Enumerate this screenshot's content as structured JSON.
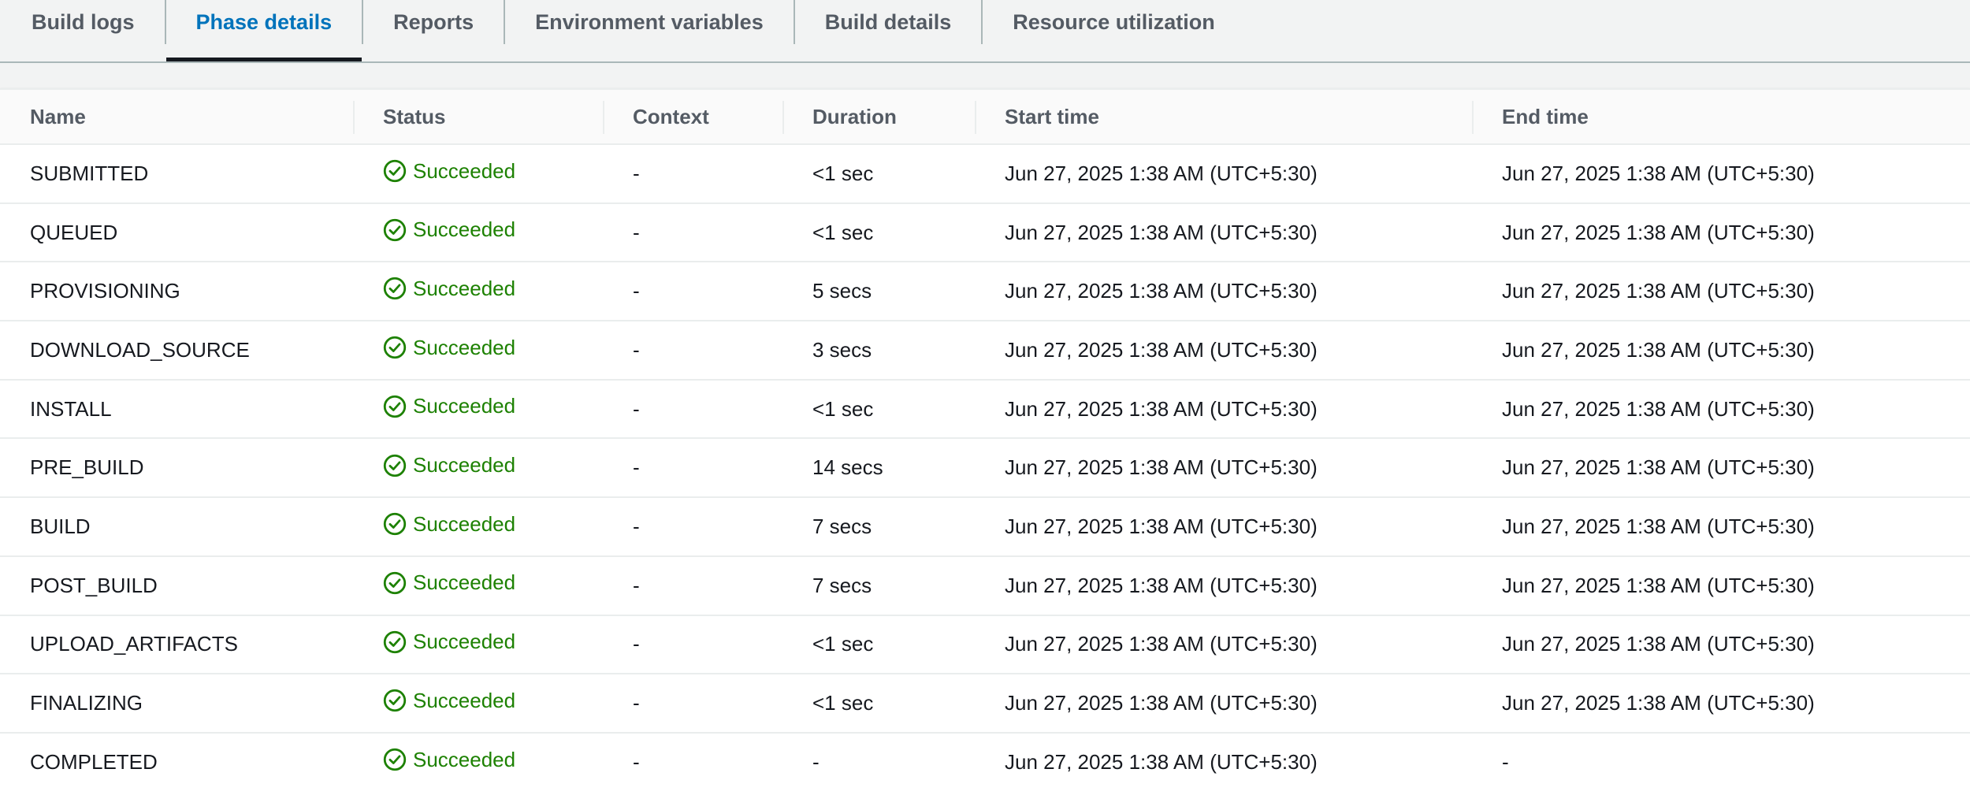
{
  "tabs": [
    {
      "label": "Build logs",
      "active": false
    },
    {
      "label": "Phase details",
      "active": true
    },
    {
      "label": "Reports",
      "active": false
    },
    {
      "label": "Environment variables",
      "active": false
    },
    {
      "label": "Build details",
      "active": false
    },
    {
      "label": "Resource utilization",
      "active": false
    }
  ],
  "table": {
    "headers": [
      "Name",
      "Status",
      "Context",
      "Duration",
      "Start time",
      "End time"
    ],
    "status_icon": "check-circle-icon",
    "colors": {
      "success": "#1d8102",
      "active_tab": "#0073bb"
    },
    "rows": [
      {
        "name": "SUBMITTED",
        "status": "Succeeded",
        "context": "-",
        "duration": "<1 sec",
        "start": "Jun 27, 2025 1:38 AM (UTC+5:30)",
        "end": "Jun 27, 2025 1:38 AM (UTC+5:30)"
      },
      {
        "name": "QUEUED",
        "status": "Succeeded",
        "context": "-",
        "duration": "<1 sec",
        "start": "Jun 27, 2025 1:38 AM (UTC+5:30)",
        "end": "Jun 27, 2025 1:38 AM (UTC+5:30)"
      },
      {
        "name": "PROVISIONING",
        "status": "Succeeded",
        "context": "-",
        "duration": "5 secs",
        "start": "Jun 27, 2025 1:38 AM (UTC+5:30)",
        "end": "Jun 27, 2025 1:38 AM (UTC+5:30)"
      },
      {
        "name": "DOWNLOAD_SOURCE",
        "status": "Succeeded",
        "context": "-",
        "duration": "3 secs",
        "start": "Jun 27, 2025 1:38 AM (UTC+5:30)",
        "end": "Jun 27, 2025 1:38 AM (UTC+5:30)"
      },
      {
        "name": "INSTALL",
        "status": "Succeeded",
        "context": "-",
        "duration": "<1 sec",
        "start": "Jun 27, 2025 1:38 AM (UTC+5:30)",
        "end": "Jun 27, 2025 1:38 AM (UTC+5:30)"
      },
      {
        "name": "PRE_BUILD",
        "status": "Succeeded",
        "context": "-",
        "duration": "14 secs",
        "start": "Jun 27, 2025 1:38 AM (UTC+5:30)",
        "end": "Jun 27, 2025 1:38 AM (UTC+5:30)"
      },
      {
        "name": "BUILD",
        "status": "Succeeded",
        "context": "-",
        "duration": "7 secs",
        "start": "Jun 27, 2025 1:38 AM (UTC+5:30)",
        "end": "Jun 27, 2025 1:38 AM (UTC+5:30)"
      },
      {
        "name": "POST_BUILD",
        "status": "Succeeded",
        "context": "-",
        "duration": "7 secs",
        "start": "Jun 27, 2025 1:38 AM (UTC+5:30)",
        "end": "Jun 27, 2025 1:38 AM (UTC+5:30)"
      },
      {
        "name": "UPLOAD_ARTIFACTS",
        "status": "Succeeded",
        "context": "-",
        "duration": "<1 sec",
        "start": "Jun 27, 2025 1:38 AM (UTC+5:30)",
        "end": "Jun 27, 2025 1:38 AM (UTC+5:30)"
      },
      {
        "name": "FINALIZING",
        "status": "Succeeded",
        "context": "-",
        "duration": "<1 sec",
        "start": "Jun 27, 2025 1:38 AM (UTC+5:30)",
        "end": "Jun 27, 2025 1:38 AM (UTC+5:30)"
      },
      {
        "name": "COMPLETED",
        "status": "Succeeded",
        "context": "-",
        "duration": "-",
        "start": "Jun 27, 2025 1:38 AM (UTC+5:30)",
        "end": "-"
      }
    ]
  }
}
